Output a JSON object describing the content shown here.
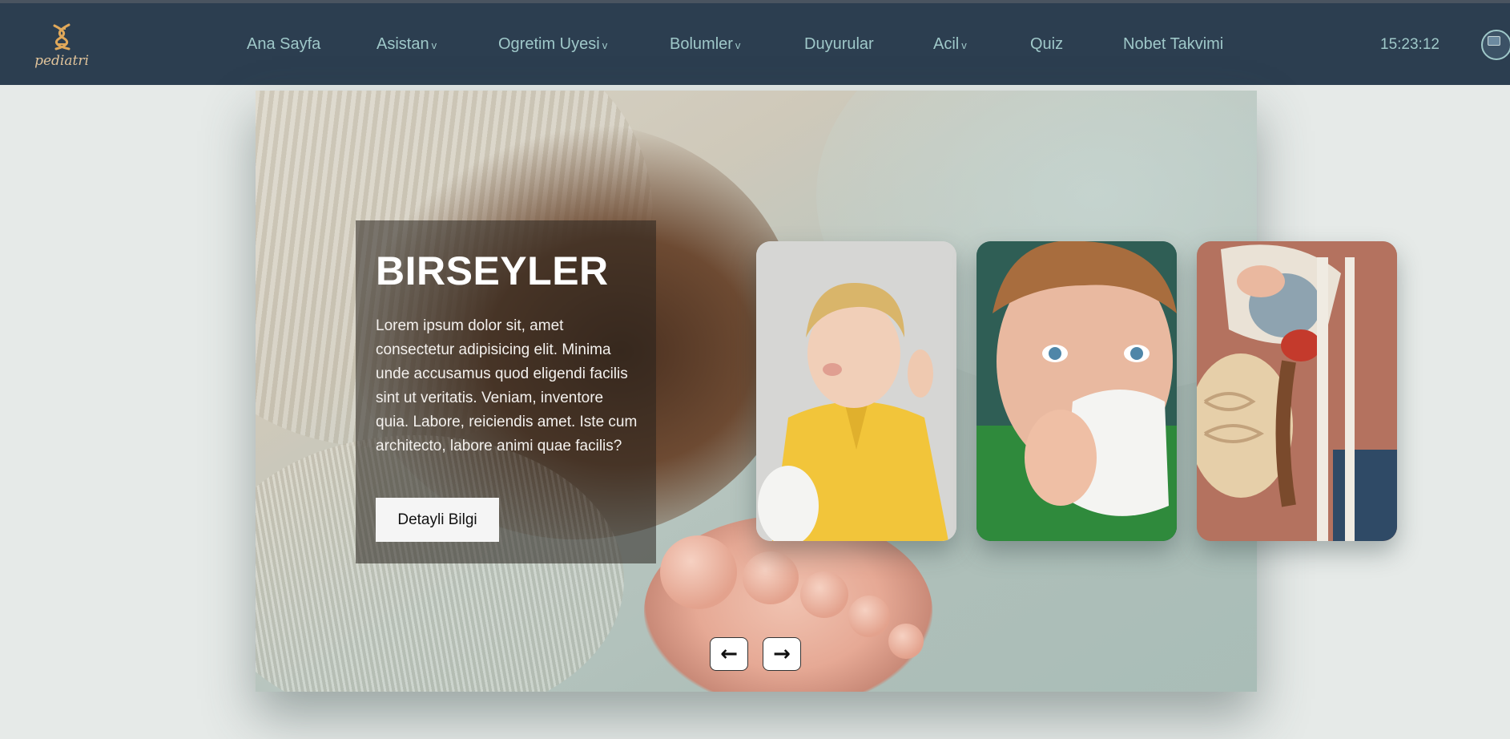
{
  "brand": {
    "name": "pediatri",
    "icon": "dna-icon"
  },
  "nav": {
    "items": [
      {
        "label": "Ana Sayfa",
        "caret": ""
      },
      {
        "label": "Asistan",
        "caret": "v"
      },
      {
        "label": "Ogretim Uyesi",
        "caret": "v"
      },
      {
        "label": "Bolumler",
        "caret": "v"
      },
      {
        "label": "Duyurular",
        "caret": ""
      },
      {
        "label": "Acil",
        "caret": "v"
      },
      {
        "label": "Quiz",
        "caret": ""
      },
      {
        "label": "Nobet Takvimi",
        "caret": ""
      }
    ],
    "clock": "15:23:12"
  },
  "hero": {
    "title": "BIRSEYLER",
    "text": "Lorem ipsum dolor sit, amet consectetur adipisicing elit. Minima unde accusamus quod eligendi facilis sint ut veritatis. Veniam, inventore quia. Labore, reiciendis amet. Iste cum architecto, labore animi quae facilis?",
    "button": "Detayli Bilgi"
  },
  "cards": [
    {
      "subject": "child-yellow-shirt-tissue"
    },
    {
      "subject": "child-blue-eyes-tissue"
    },
    {
      "subject": "anatomy-skeleton-model"
    }
  ],
  "controls": {
    "prev_icon": "←",
    "next_icon": "→"
  },
  "colors": {
    "navbar": "#2c3e50",
    "nav_text": "#9fc8c9",
    "background": "#e6eae8",
    "logo": "#e0c39a"
  }
}
